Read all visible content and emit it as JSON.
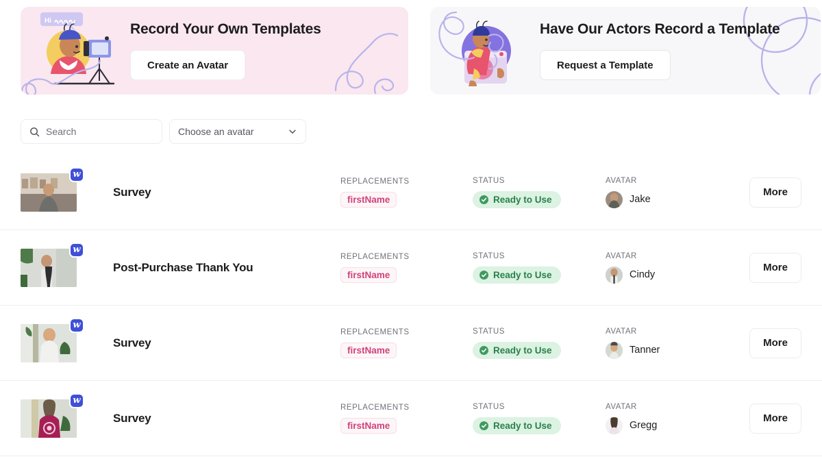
{
  "banners": [
    {
      "id": "record-own",
      "title": "Record Your Own Templates",
      "button": "Create an Avatar",
      "bubble_text": "Hi",
      "bg": "#fae7ef"
    },
    {
      "id": "actors-record",
      "title": "Have Our Actors Record a Template",
      "button": "Request a Template",
      "bg": "#f7f7f9"
    }
  ],
  "filters": {
    "search_placeholder": "Search",
    "search_value": "",
    "avatar_select_value": "Choose an avatar"
  },
  "columns": {
    "replacements": "REPLACEMENTS",
    "status": "STATUS",
    "avatar": "AVATAR"
  },
  "more_label": "More",
  "status_color": "#29804a",
  "chip_color": "#d1417b",
  "rows": [
    {
      "title": "Survey",
      "replacement": "firstName",
      "status": "Ready to Use",
      "avatar_name": "Jake",
      "more": "More"
    },
    {
      "title": "Post-Purchase Thank You",
      "replacement": "firstName",
      "status": "Ready to Use",
      "avatar_name": "Cindy",
      "more": "More"
    },
    {
      "title": "Survey",
      "replacement": "firstName",
      "status": "Ready to Use",
      "avatar_name": "Tanner",
      "more": "More"
    },
    {
      "title": "Survey",
      "replacement": "firstName",
      "status": "Ready to Use",
      "avatar_name": "Gregg",
      "more": "More"
    }
  ]
}
